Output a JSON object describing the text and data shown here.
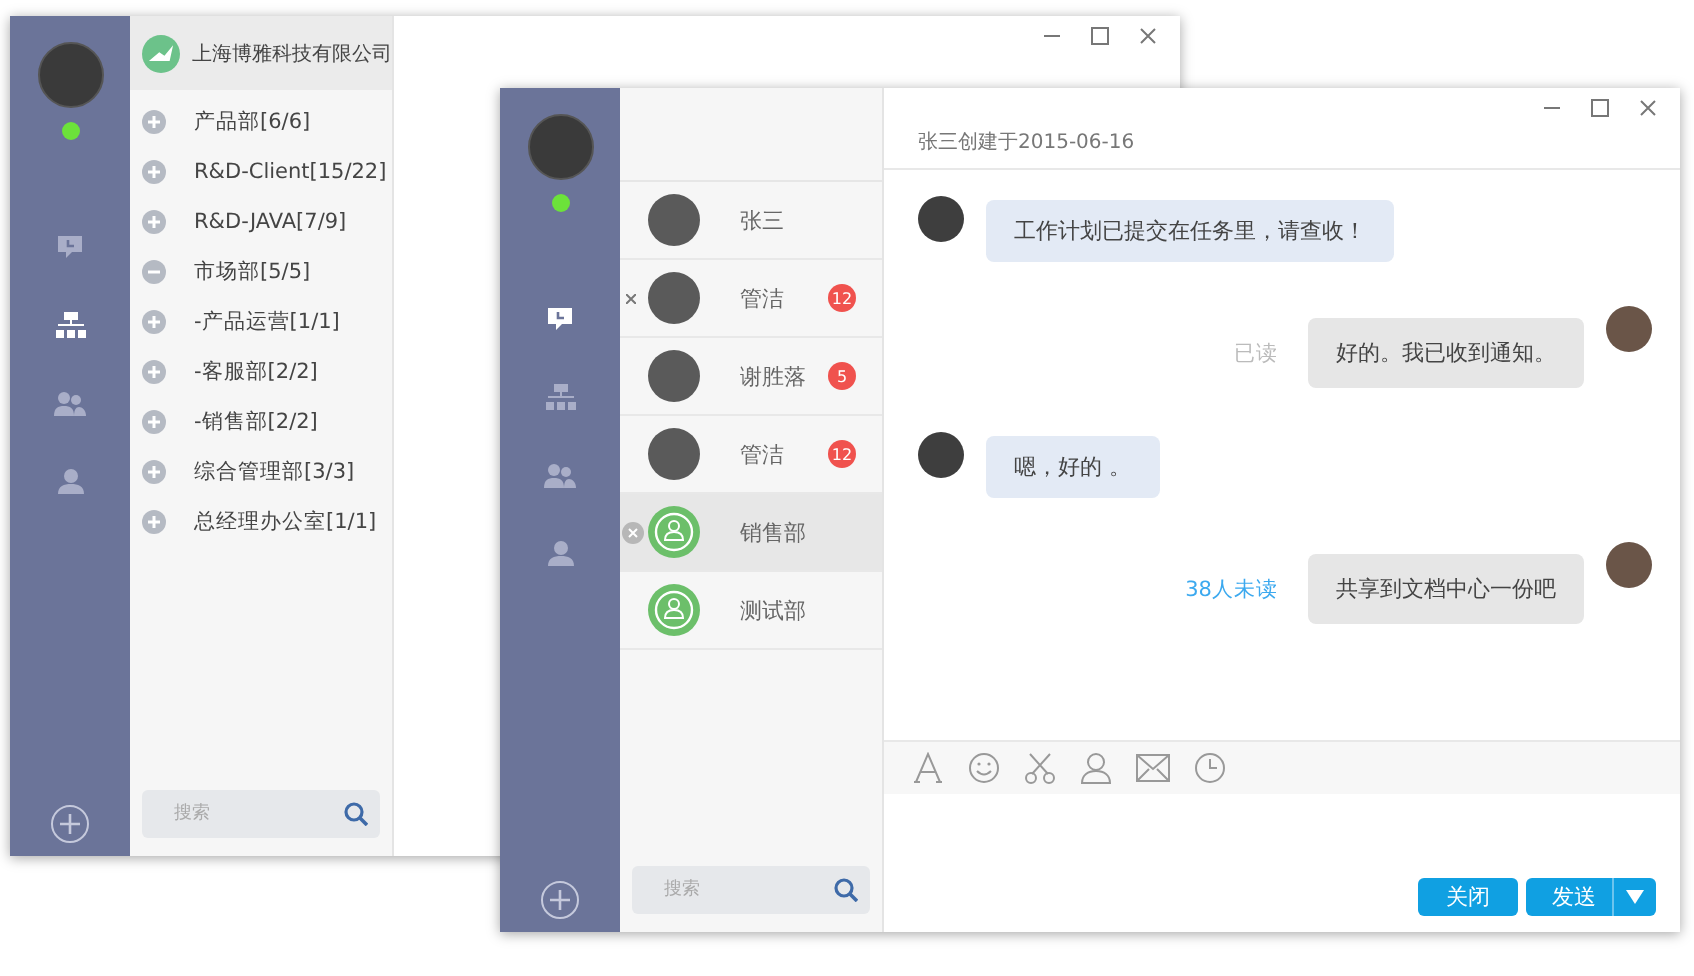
{
  "windows": [
    {
      "kind": "org",
      "online": true,
      "nav": [
        {
          "kind": "chat",
          "selected": false
        },
        {
          "kind": "org",
          "selected": true
        },
        {
          "kind": "groups",
          "selected": false
        },
        {
          "kind": "person",
          "selected": false
        }
      ],
      "company": "上海博雅科技有限公司",
      "departments": [
        {
          "label": "产品部[6/6]",
          "expanded": false
        },
        {
          "label": "R&D-Client[15/22]",
          "expanded": false
        },
        {
          "label": "R&D-JAVA[7/9]",
          "expanded": false
        },
        {
          "label": "市场部[5/5]",
          "expanded": true
        },
        {
          "label": "-产品运营[1/1]",
          "expanded": false
        },
        {
          "label": "-客服部[2/2]",
          "expanded": false
        },
        {
          "label": "-销售部[2/2]",
          "expanded": false
        },
        {
          "label": "综合管理部[3/3]",
          "expanded": false
        },
        {
          "label": "总经理办公室[1/1]",
          "expanded": false
        }
      ],
      "search": {
        "placeholder": "搜索"
      }
    },
    {
      "kind": "chat",
      "online": true,
      "nav": [
        {
          "kind": "chat",
          "selected": true
        },
        {
          "kind": "org",
          "selected": false
        },
        {
          "kind": "groups",
          "selected": false
        },
        {
          "kind": "person",
          "selected": false
        }
      ],
      "conversations": [
        {
          "name": "张三",
          "kind": "person",
          "closable": false,
          "selected": false
        },
        {
          "name": "管洁",
          "kind": "person",
          "badge": "12",
          "closable": true,
          "selected": false
        },
        {
          "name": "谢胜落",
          "kind": "person",
          "badge": "5",
          "closable": false,
          "selected": false
        },
        {
          "name": "管洁",
          "kind": "person",
          "badge": "12",
          "closable": false,
          "selected": false
        },
        {
          "name": "销售部",
          "kind": "group",
          "closable": true,
          "selected": true
        },
        {
          "name": "测试部",
          "kind": "group",
          "closable": false,
          "selected": false
        }
      ],
      "search": {
        "placeholder": "搜索"
      },
      "header": "张三创建于2015-06-16",
      "messages": [
        {
          "kind": "incoming",
          "text": "工作计划已提交在任务里，请查收！"
        },
        {
          "kind": "outgoing",
          "text": "好的。我已收到通知。",
          "status": "已读",
          "unread": false
        },
        {
          "kind": "incoming",
          "text": "嗯，好的 。"
        },
        {
          "kind": "outgoing",
          "text": "共享到文档中心一份吧",
          "status": "38人未读",
          "unread": true
        }
      ],
      "buttons": [
        {
          "label": "关闭",
          "kind": "plain"
        },
        {
          "label": "发送",
          "kind": "split"
        }
      ]
    }
  ]
}
